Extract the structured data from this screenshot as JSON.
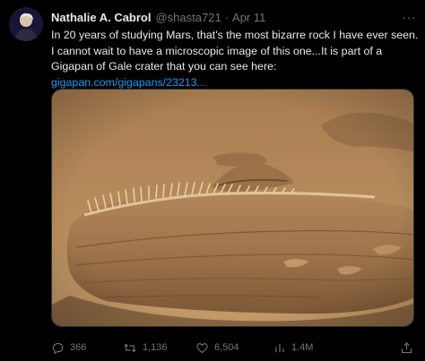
{
  "tweet": {
    "author": {
      "display_name": "Nathalie A. Cabrol",
      "handle": "@shasta721",
      "avatar_icon": "profile-photo"
    },
    "separator": "·",
    "date": "Apr 11",
    "more_icon": "more-horizontal-icon",
    "text_lines": [
      "In 20 years of studying Mars, that's the most bizarre rock I have ever seen.",
      "I cannot wait to have a microscopic image of this one...It is part of a",
      "Gigapan of Gale crater that you can see here:"
    ],
    "link_text": "gigapan.com/gigapans/23213...",
    "media": {
      "icon": "photo",
      "colors": {
        "sand": "#b88e5e",
        "rock": "#a47a50",
        "shadow": "#5a3c22"
      }
    },
    "actions": {
      "reply": {
        "icon": "reply-icon",
        "count": "366"
      },
      "retweet": {
        "icon": "retweet-icon",
        "count": "1,136"
      },
      "like": {
        "icon": "heart-icon",
        "count": "6,504"
      },
      "views": {
        "icon": "views-icon",
        "count": "1.4M"
      },
      "share": {
        "icon": "share-icon"
      }
    }
  },
  "colors": {
    "background": "#000000",
    "text": "#e7e9ea",
    "muted": "#71767b",
    "link": "#1d9bf0",
    "border": "#2f3336"
  }
}
